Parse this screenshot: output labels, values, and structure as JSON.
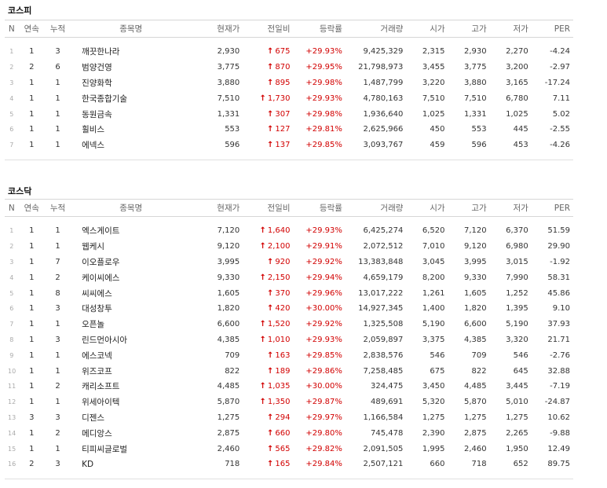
{
  "headers": {
    "n": "N",
    "consecutive": "연속",
    "cumulative": "누적",
    "name": "종목명",
    "price": "현재가",
    "diff": "전일비",
    "rate": "등락률",
    "volume": "거래량",
    "open": "시가",
    "high": "고가",
    "low": "저가",
    "per": "PER"
  },
  "colors": {
    "up": "#d20000",
    "arrow_glyph": "up-arrow-icon"
  },
  "kospi": {
    "title": "코스피",
    "rows": [
      {
        "n": "1",
        "con": "1",
        "cum": "3",
        "name": "깨끗한나라",
        "price": "2,930",
        "diff": "675",
        "rate": "+29.93%",
        "vol": "9,425,329",
        "open": "2,315",
        "high": "2,930",
        "low": "2,270",
        "per": "-4.24"
      },
      {
        "n": "2",
        "con": "2",
        "cum": "6",
        "name": "범양건영",
        "price": "3,775",
        "diff": "870",
        "rate": "+29.95%",
        "vol": "21,798,973",
        "open": "3,455",
        "high": "3,775",
        "low": "3,200",
        "per": "-2.97"
      },
      {
        "n": "3",
        "con": "1",
        "cum": "1",
        "name": "진양화학",
        "price": "3,880",
        "diff": "895",
        "rate": "+29.98%",
        "vol": "1,487,799",
        "open": "3,220",
        "high": "3,880",
        "low": "3,165",
        "per": "-17.24"
      },
      {
        "n": "4",
        "con": "1",
        "cum": "1",
        "name": "한국종합기술",
        "price": "7,510",
        "diff": "1,730",
        "rate": "+29.93%",
        "vol": "4,780,163",
        "open": "7,510",
        "high": "7,510",
        "low": "6,780",
        "per": "7.11"
      },
      {
        "n": "5",
        "con": "1",
        "cum": "1",
        "name": "동원금속",
        "price": "1,331",
        "diff": "307",
        "rate": "+29.98%",
        "vol": "1,936,640",
        "open": "1,025",
        "high": "1,331",
        "low": "1,025",
        "per": "5.02"
      },
      {
        "n": "6",
        "con": "1",
        "cum": "1",
        "name": "휠비스",
        "price": "553",
        "diff": "127",
        "rate": "+29.81%",
        "vol": "2,625,966",
        "open": "450",
        "high": "553",
        "low": "445",
        "per": "-2.55"
      },
      {
        "n": "7",
        "con": "1",
        "cum": "1",
        "name": "에넥스",
        "price": "596",
        "diff": "137",
        "rate": "+29.85%",
        "vol": "3,093,767",
        "open": "459",
        "high": "596",
        "low": "453",
        "per": "-4.26"
      }
    ]
  },
  "kosdaq": {
    "title": "코스닥",
    "rows": [
      {
        "n": "1",
        "con": "1",
        "cum": "1",
        "name": "엑스게이트",
        "price": "7,120",
        "diff": "1,640",
        "rate": "+29.93%",
        "vol": "6,425,274",
        "open": "6,520",
        "high": "7,120",
        "low": "6,370",
        "per": "51.59"
      },
      {
        "n": "2",
        "con": "1",
        "cum": "1",
        "name": "웹케시",
        "price": "9,120",
        "diff": "2,100",
        "rate": "+29.91%",
        "vol": "2,072,512",
        "open": "7,010",
        "high": "9,120",
        "low": "6,980",
        "per": "29.90"
      },
      {
        "n": "3",
        "con": "1",
        "cum": "7",
        "name": "이오플로우",
        "price": "3,995",
        "diff": "920",
        "rate": "+29.92%",
        "vol": "13,383,848",
        "open": "3,045",
        "high": "3,995",
        "low": "3,015",
        "per": "-1.92"
      },
      {
        "n": "4",
        "con": "1",
        "cum": "2",
        "name": "케이씨에스",
        "price": "9,330",
        "diff": "2,150",
        "rate": "+29.94%",
        "vol": "4,659,179",
        "open": "8,200",
        "high": "9,330",
        "low": "7,990",
        "per": "58.31"
      },
      {
        "n": "5",
        "con": "1",
        "cum": "8",
        "name": "씨씨에스",
        "price": "1,605",
        "diff": "370",
        "rate": "+29.96%",
        "vol": "13,017,222",
        "open": "1,261",
        "high": "1,605",
        "low": "1,252",
        "per": "45.86"
      },
      {
        "n": "6",
        "con": "1",
        "cum": "3",
        "name": "대성창투",
        "price": "1,820",
        "diff": "420",
        "rate": "+30.00%",
        "vol": "14,927,345",
        "open": "1,400",
        "high": "1,820",
        "low": "1,395",
        "per": "9.10"
      },
      {
        "n": "7",
        "con": "1",
        "cum": "1",
        "name": "오픈놀",
        "price": "6,600",
        "diff": "1,520",
        "rate": "+29.92%",
        "vol": "1,325,508",
        "open": "5,190",
        "high": "6,600",
        "low": "5,190",
        "per": "37.93"
      },
      {
        "n": "8",
        "con": "1",
        "cum": "3",
        "name": "린드먼아시아",
        "price": "4,385",
        "diff": "1,010",
        "rate": "+29.93%",
        "vol": "2,059,897",
        "open": "3,375",
        "high": "4,385",
        "low": "3,320",
        "per": "21.71"
      },
      {
        "n": "9",
        "con": "1",
        "cum": "1",
        "name": "에스코넥",
        "price": "709",
        "diff": "163",
        "rate": "+29.85%",
        "vol": "2,838,576",
        "open": "546",
        "high": "709",
        "low": "546",
        "per": "-2.76"
      },
      {
        "n": "10",
        "con": "1",
        "cum": "1",
        "name": "위즈코프",
        "price": "822",
        "diff": "189",
        "rate": "+29.86%",
        "vol": "7,258,485",
        "open": "675",
        "high": "822",
        "low": "645",
        "per": "32.88"
      },
      {
        "n": "11",
        "con": "1",
        "cum": "2",
        "name": "캐리소프트",
        "price": "4,485",
        "diff": "1,035",
        "rate": "+30.00%",
        "vol": "324,475",
        "open": "3,450",
        "high": "4,485",
        "low": "3,445",
        "per": "-7.19"
      },
      {
        "n": "12",
        "con": "1",
        "cum": "1",
        "name": "위세아이텍",
        "price": "5,870",
        "diff": "1,350",
        "rate": "+29.87%",
        "vol": "489,691",
        "open": "5,320",
        "high": "5,870",
        "low": "5,010",
        "per": "-24.87"
      },
      {
        "n": "13",
        "con": "3",
        "cum": "3",
        "name": "디젠스",
        "price": "1,275",
        "diff": "294",
        "rate": "+29.97%",
        "vol": "1,166,584",
        "open": "1,275",
        "high": "1,275",
        "low": "1,275",
        "per": "10.62"
      },
      {
        "n": "14",
        "con": "1",
        "cum": "2",
        "name": "메디앙스",
        "price": "2,875",
        "diff": "660",
        "rate": "+29.80%",
        "vol": "745,478",
        "open": "2,390",
        "high": "2,875",
        "low": "2,265",
        "per": "-9.88"
      },
      {
        "n": "15",
        "con": "1",
        "cum": "1",
        "name": "티피씨글로벌",
        "price": "2,460",
        "diff": "565",
        "rate": "+29.82%",
        "vol": "2,091,505",
        "open": "1,995",
        "high": "2,460",
        "low": "1,950",
        "per": "12.49"
      },
      {
        "n": "16",
        "con": "2",
        "cum": "3",
        "name": "KD",
        "price": "718",
        "diff": "165",
        "rate": "+29.84%",
        "vol": "2,507,121",
        "open": "660",
        "high": "718",
        "low": "652",
        "per": "89.75"
      }
    ]
  }
}
